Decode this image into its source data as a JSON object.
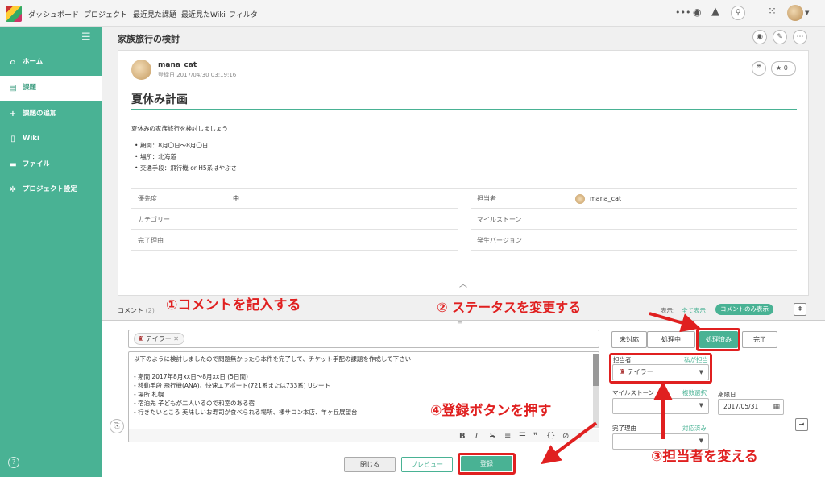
{
  "nav": {
    "links": [
      "ダッシュボード",
      "プロジェクト",
      "最近見た課題",
      "最近見たWiki",
      "フィルタ"
    ]
  },
  "sidebar": {
    "items": [
      {
        "label": "ホーム",
        "icon": "home-icon"
      },
      {
        "label": "課題",
        "icon": "list-icon"
      },
      {
        "label": "課題の追加",
        "icon": "plus-icon"
      },
      {
        "label": "Wiki",
        "icon": "wiki-icon"
      },
      {
        "label": "ファイル",
        "icon": "folder-icon"
      },
      {
        "label": "プロジェクト設定",
        "icon": "gear-icon"
      }
    ],
    "active_index": 1
  },
  "page": {
    "title": "家族旅行の検討"
  },
  "issue": {
    "author": "mana_cat",
    "registered": "登録日 2017/04/30 03:19:16",
    "star_count": "0",
    "heading": "夏休み計画",
    "intro": "夏休みの家族旅行を検討しましょう",
    "bullets": [
      "期間：8月〇日～8月〇日",
      "場所：北海道",
      "交通手段：飛行機 or H5系はやぶさ"
    ],
    "props_left": [
      {
        "label": "優先度",
        "value": "中"
      },
      {
        "label": "カテゴリー",
        "value": ""
      },
      {
        "label": "完了理由",
        "value": ""
      }
    ],
    "props_right": [
      {
        "label": "担当者",
        "value": "mana_cat"
      },
      {
        "label": "マイルストーン",
        "value": ""
      },
      {
        "label": "発生バージョン",
        "value": ""
      }
    ]
  },
  "comments": {
    "label": "コメント",
    "count": "(2)",
    "display_label": "表示:",
    "show_all": "全て表示",
    "show_comments_only": "コメントのみ表示"
  },
  "annotations": {
    "a1": "①コメントを記入する",
    "a2": "② ステータスを変更する",
    "a3": "③担当者を変える",
    "a4": "④登録ボタンを押す"
  },
  "editor": {
    "notify_user": "テイラー",
    "lines": [
      "以下のように検討しましたので問題無かったら本件を完了して、チケット手配の課題を作成して下さい",
      "",
      "- 期間 2017年8月xx日～8月xx日 (5日間)",
      "- 移動手段 飛行機(ANA)、快速エアポート(721系または733系) Uシート",
      "- 場所 札幌",
      "- 宿泊先 子どもが二人いるので和室のある宿",
      "- 行きたいところ 美味しいお寿司が食べられる場所、榛サロン本店、羊ヶ丘展望台"
    ],
    "toolbar": [
      "B",
      "I",
      "S",
      "≡",
      "☰",
      "❞",
      "{}",
      "⊘",
      "?"
    ]
  },
  "status": {
    "options": [
      "未対応",
      "処理中",
      "処理済み",
      "完了"
    ],
    "selected": "処理済み"
  },
  "fields": {
    "assignee_label": "担当者",
    "assign_me": "私が担当",
    "assignee_value": "テイラー",
    "milestone_label": "マイルストーン",
    "multi_select": "複数選択",
    "due_label": "期限日",
    "due_value": "2017/05/31",
    "resolution_label": "完了理由",
    "resolution_link": "対応済み"
  },
  "buttons": {
    "close": "閉じる",
    "preview": "プレビュー",
    "submit": "登録"
  },
  "colors": {
    "accent": "#49b294",
    "annotation_red": "#e02020"
  }
}
